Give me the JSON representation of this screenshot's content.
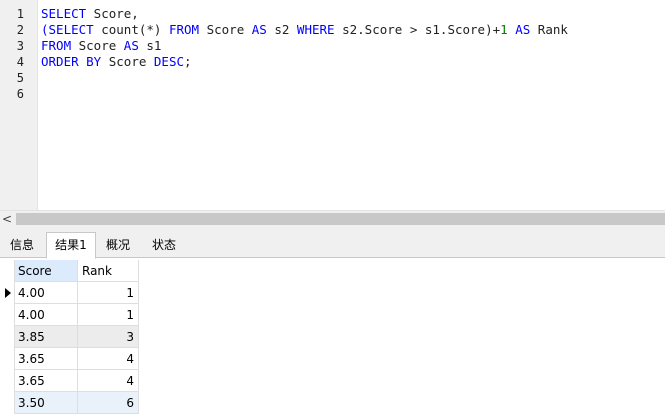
{
  "editor": {
    "line_numbers": [
      "1",
      "2",
      "3",
      "4",
      "5",
      "6"
    ],
    "lines": [
      [
        {
          "t": "SELECT",
          "c": "kw"
        },
        {
          "t": " Score,",
          "c": "plain"
        }
      ],
      [
        {
          "t": "(SELECT",
          "c": "kw"
        },
        {
          "t": " count(*) ",
          "c": "plain"
        },
        {
          "t": "FROM",
          "c": "kw"
        },
        {
          "t": " Score ",
          "c": "plain"
        },
        {
          "t": "AS",
          "c": "kw"
        },
        {
          "t": " s2 ",
          "c": "plain"
        },
        {
          "t": "WHERE",
          "c": "kw"
        },
        {
          "t": " s2.Score > s1.Score)+",
          "c": "plain"
        },
        {
          "t": "1",
          "c": "num"
        },
        {
          "t": " ",
          "c": "plain"
        },
        {
          "t": "AS",
          "c": "kw"
        },
        {
          "t": " Rank",
          "c": "plain"
        }
      ],
      [
        {
          "t": "FROM",
          "c": "kw"
        },
        {
          "t": " Score ",
          "c": "plain"
        },
        {
          "t": "AS",
          "c": "kw"
        },
        {
          "t": " s1",
          "c": "plain"
        }
      ],
      [
        {
          "t": "ORDER BY",
          "c": "kw"
        },
        {
          "t": " Score ",
          "c": "plain"
        },
        {
          "t": "DESC",
          "c": "kw"
        },
        {
          "t": ";",
          "c": "plain"
        }
      ],
      [],
      []
    ]
  },
  "scrollbar": {
    "left_arrow": "<"
  },
  "tabs": [
    {
      "label": "信息",
      "active": false
    },
    {
      "label": "结果1",
      "active": true
    },
    {
      "label": "概况",
      "active": false
    },
    {
      "label": "状态",
      "active": false
    }
  ],
  "results": {
    "columns": [
      "Score",
      "Rank"
    ],
    "rows": [
      {
        "score": "4.00",
        "rank": "1",
        "current": true
      },
      {
        "score": "4.00",
        "rank": "1"
      },
      {
        "score": "3.85",
        "rank": "3",
        "shade": true
      },
      {
        "score": "3.65",
        "rank": "4"
      },
      {
        "score": "3.65",
        "rank": "4"
      },
      {
        "score": "3.50",
        "rank": "6",
        "selected": true
      }
    ]
  },
  "colors": {
    "keyword": "#0000ff",
    "number": "#008000",
    "header_highlight": "#dcebfb"
  }
}
